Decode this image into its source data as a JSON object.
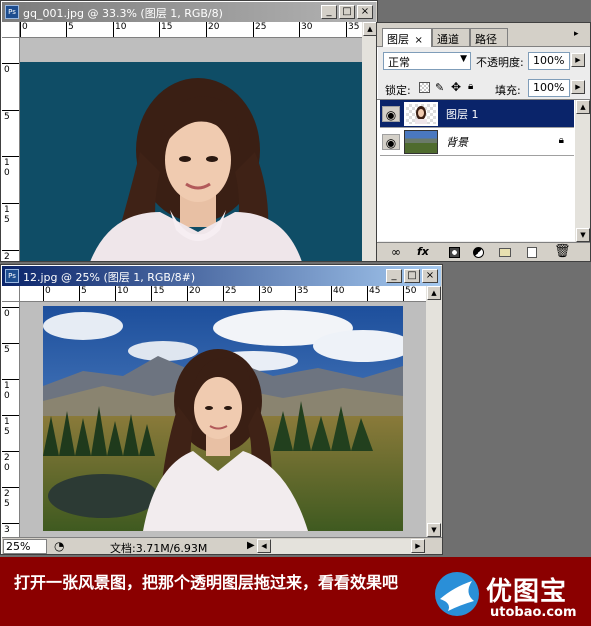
{
  "win1": {
    "app_icon": "Ps",
    "title": "gq_001.jpg @ 33.3% (图层 1, RGB/8)",
    "ruler_h": [
      "0",
      "5",
      "10",
      "15",
      "20",
      "25",
      "30",
      "35"
    ],
    "ruler_v": [
      "0",
      "5",
      "1\n0",
      "1\n5",
      "2"
    ]
  },
  "win2": {
    "app_icon": "Ps",
    "title": "12.jpg @ 25% (图层 1, RGB/8#)",
    "ruler_h": [
      "0",
      "5",
      "10",
      "15",
      "20",
      "25",
      "30",
      "35",
      "40",
      "45",
      "50"
    ],
    "ruler_v": [
      "0",
      "5",
      "1\n0",
      "1\n5",
      "2\n0",
      "2\n5",
      "3"
    ],
    "zoom": "25%",
    "doc_info": "文档:3.71M/6.93M"
  },
  "window_buttons": {
    "minimize": "_",
    "maximize": "□",
    "close": "×"
  },
  "panel": {
    "tabs": [
      "图层",
      "通道",
      "路径"
    ],
    "tab_close": "×",
    "blend_mode": "正常",
    "opacity_label": "不透明度:",
    "opacity_value": "100%",
    "lock_label": "锁定:",
    "fill_label": "填充:",
    "fill_value": "100%",
    "layers": [
      {
        "name": "图层 1",
        "selected": true,
        "visible": true
      },
      {
        "name": "背景",
        "selected": false,
        "visible": true,
        "locked": true
      }
    ],
    "footer_icons": [
      "link-icon",
      "fx-icon",
      "mask-icon",
      "adjustment-icon",
      "folder-icon",
      "new-layer-icon",
      "trash-icon"
    ],
    "fx_label": "fx"
  },
  "banner": {
    "text": "打开一张风景图，把那个透明图层拖过来，看看效果吧",
    "logo_cn": "优图宝",
    "logo_url": "utobao.com"
  },
  "colors": {
    "canvas_teal": "#0f4d66",
    "banner_red": "#8b0000",
    "selection_navy": "#0a246a"
  }
}
